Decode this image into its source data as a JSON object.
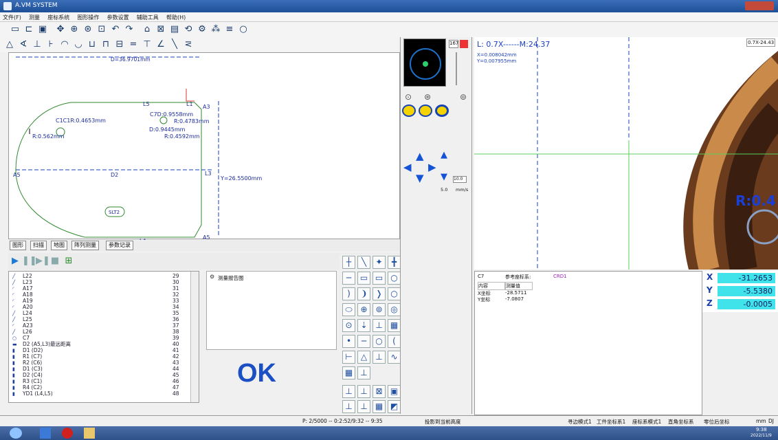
{
  "window": {
    "title": "A.VM SYSTEM"
  },
  "menu": [
    "文件(F)",
    "测量",
    "座标系统",
    "图形操作",
    "参数设置",
    "辅助工具",
    "帮助(H)"
  ],
  "drawing": {
    "labels": {
      "top_dim": "D=36.9701mm",
      "right_dim": "Y=26.5500mm",
      "L5": "L5",
      "L1": "L1",
      "A3": "A3",
      "A5": "A5",
      "D2": "D2",
      "L3": "L3",
      "L4": "L4",
      "A5b": "A5",
      "c7": "C7D:0.9558mm",
      "r1": "R:0.4783mm",
      "c1": "C1C1R:0.4653mm",
      "d04": "D:0.9445mm",
      "r04": "R:0.4592mm",
      "r0562": "R:0.562mm",
      "slt2": "SLT2"
    }
  },
  "tabs": [
    "图形",
    "扫描",
    "地图",
    "阵列测量",
    "参数记录"
  ],
  "elements": [
    {
      "name": "L22",
      "no": "29"
    },
    {
      "name": "L23",
      "no": "30"
    },
    {
      "name": "A17",
      "no": "31"
    },
    {
      "name": "A18",
      "no": "32"
    },
    {
      "name": "A19",
      "no": "33"
    },
    {
      "name": "A20",
      "no": "34"
    },
    {
      "name": "L24",
      "no": "35"
    },
    {
      "name": "L25",
      "no": "36"
    },
    {
      "name": "A23",
      "no": "37"
    },
    {
      "name": "L26",
      "no": "38"
    },
    {
      "name": "C7",
      "no": "39"
    },
    {
      "name": "D2 (A5,L3)最远距离",
      "no": "40"
    },
    {
      "name": "D1 (D2)",
      "no": "41"
    },
    {
      "name": "R1 (C7)",
      "no": "42"
    },
    {
      "name": "R2 (C6)",
      "no": "43"
    },
    {
      "name": "D1 (C3)",
      "no": "44"
    },
    {
      "name": "D2 (C4)",
      "no": "45"
    },
    {
      "name": "R3 (C1)",
      "no": "46"
    },
    {
      "name": "R4 (C2)",
      "no": "47"
    },
    {
      "name": "YD1 (L4,L5)",
      "no": "48"
    }
  ],
  "tree": {
    "root": "测量报告图"
  },
  "result": "OK",
  "camera_ctrl": {
    "count": "167",
    "speed": "10.0",
    "rate": "5.0",
    "unit": "mm/s"
  },
  "camera": {
    "zoom": "L: 0.7X------M:24.37",
    "x": "X=0.008042mm",
    "y": "Y=0.007955mm",
    "corner": "0.7X-24.43",
    "big_label": "R:0.4"
  },
  "measure": {
    "name": "C7",
    "ref_label": "参考座标系:",
    "ref_value": "CRD1",
    "col_content": "内容",
    "col_value": "测量值",
    "rows": [
      {
        "k": "X坐标",
        "v": "-28.5711"
      },
      {
        "k": "Y坐标",
        "v": "-7.0807"
      }
    ]
  },
  "coords": {
    "x": "-31.2653",
    "y": "-5.5380",
    "z": "-0.0005",
    "xl": "X",
    "yl": "Y",
    "zl": "Z"
  },
  "status": {
    "left": "P: 2/5000 -- 0:2:52/9:32 -- 9:35",
    "mid": "投影到当前高度",
    "r1": "寻边模式1",
    "r2": "工件坐标系1",
    "r3": "座标系模式1",
    "r4": "直角坐标系",
    "r5": "零位后坐标",
    "r6": "mm",
    "r7": "DJ"
  },
  "clock": {
    "time": "9:38",
    "date": "2022/11/9"
  }
}
